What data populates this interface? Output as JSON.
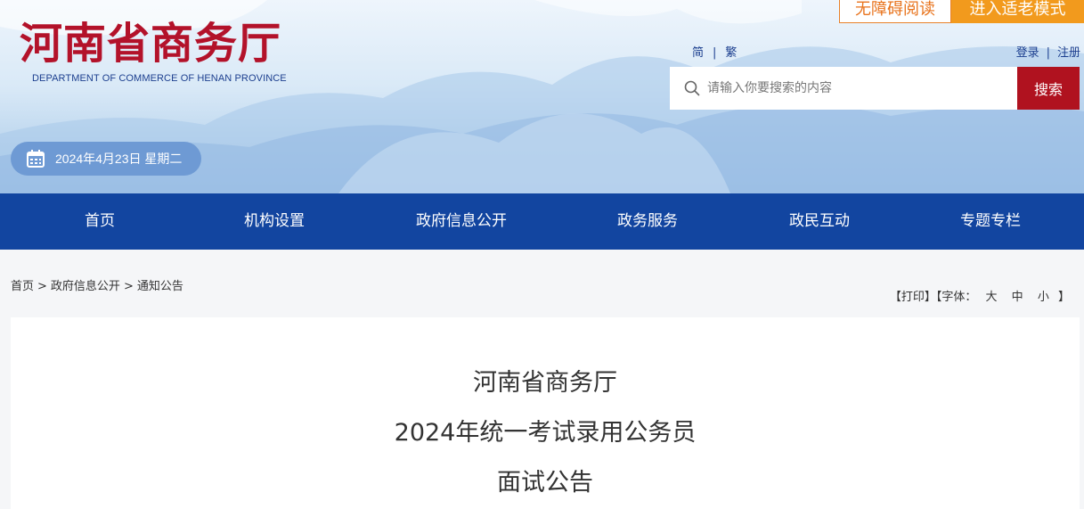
{
  "header": {
    "logo_cn": "河南省商务厅",
    "logo_en": "DEPARTMENT OF COMMERCE OF HENAN PROVINCE",
    "date": "2024年4月23日 星期二",
    "accessibility_btn": "无障碍阅读",
    "elder_mode_btn": "进入适老模式",
    "lang_simplified": "简",
    "lang_divider": "|",
    "lang_traditional": "繁",
    "login": "登录",
    "auth_divider": "|",
    "register": "注册",
    "search_placeholder": "请输入你要搜索的内容",
    "search_btn": "搜索"
  },
  "nav": {
    "items": [
      "首页",
      "机构设置",
      "政府信息公开",
      "政务服务",
      "政民互动",
      "专题专栏"
    ]
  },
  "breadcrumb": {
    "home": "首页",
    "level1": "政府信息公开",
    "level2": "通知公告",
    "separator": ">"
  },
  "tools": {
    "print": "【打印】",
    "font_label": "【字体：",
    "large": "大",
    "medium": "中",
    "small": "小",
    "close": "】"
  },
  "article": {
    "title_line1": "河南省商务厅",
    "title_line2": "2024年统一考试录用公务员",
    "title_line3": "面试公告"
  },
  "colors": {
    "brand_red": "#b3122a",
    "nav_blue": "#1245a0",
    "accent_orange": "#f29a1d"
  }
}
